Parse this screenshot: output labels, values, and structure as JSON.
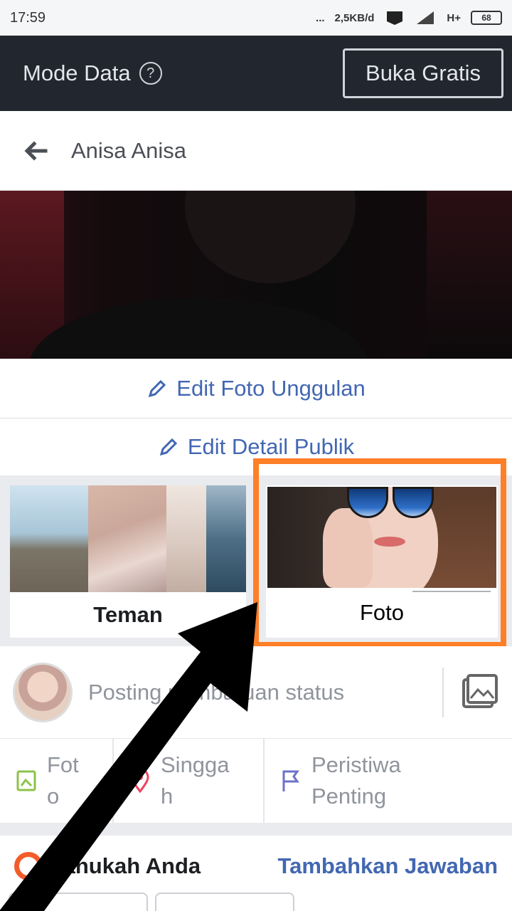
{
  "status_bar": {
    "time": "17:59",
    "dots": "...",
    "speed": "2,5KB/d",
    "network": "H+",
    "battery": "68"
  },
  "data_bar": {
    "label": "Mode Data",
    "help_glyph": "?",
    "free_button": "Buka Gratis"
  },
  "header": {
    "title": "Anisa Anisa"
  },
  "edit": {
    "featured": "Edit Foto Unggulan",
    "public_details": "Edit Detail Publik"
  },
  "cards": {
    "friends_label": "Teman",
    "photos_label": "Foto"
  },
  "composer": {
    "placeholder": "Posting pembaruan status"
  },
  "actions": [
    {
      "label": "Fot\no",
      "icon": "photo-icon"
    },
    {
      "label": "Singga\nh",
      "icon": "location-pin-icon"
    },
    {
      "label": "Peristiwa\nPenting",
      "icon": "flag-icon"
    }
  ],
  "did_you_know": {
    "title": "Tahukah Anda",
    "link": "Tambahkan Jawaban"
  },
  "colors": {
    "accent_highlight": "#ff7f27",
    "link_blue": "#4267b2",
    "data_bar_bg": "#22262e"
  }
}
